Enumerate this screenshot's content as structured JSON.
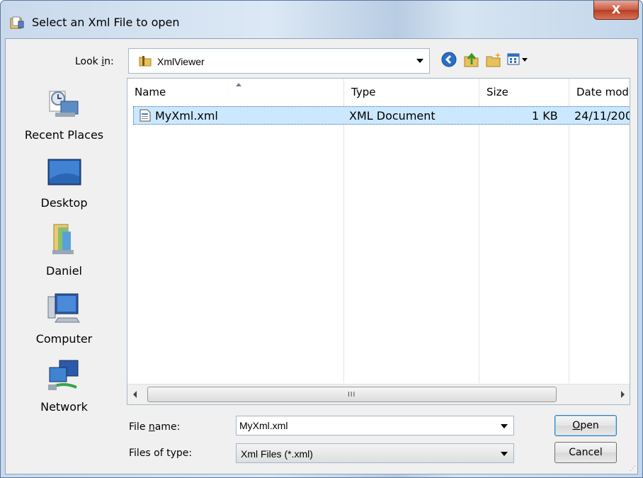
{
  "window": {
    "title": "Select an Xml File to open",
    "close_glyph": "X"
  },
  "lookin": {
    "label": "Look in:",
    "label_prefix": "Look ",
    "label_accel": "i",
    "label_suffix": "n:",
    "value": "XmlViewer"
  },
  "places": [
    {
      "label": "Recent Places",
      "icon": "recent-places-icon"
    },
    {
      "label": "Desktop",
      "icon": "desktop-icon"
    },
    {
      "label": "Daniel",
      "icon": "user-folder-icon"
    },
    {
      "label": "Computer",
      "icon": "computer-icon"
    },
    {
      "label": "Network",
      "icon": "network-icon"
    }
  ],
  "columns": {
    "name": "Name",
    "type": "Type",
    "size": "Size",
    "date": "Date mod"
  },
  "files": [
    {
      "name": "MyXml.xml",
      "type": "XML Document",
      "size": "1 KB",
      "date": "24/11/200"
    }
  ],
  "scrollbar": {
    "grip": "III"
  },
  "filename": {
    "label_prefix": "File ",
    "label_accel": "n",
    "label_suffix": "ame:",
    "value": "MyXml.xml"
  },
  "filetype": {
    "label": "Files of type:",
    "value": "Xml Files (*.xml)"
  },
  "buttons": {
    "open_accel": "O",
    "open_rest": "pen",
    "cancel": "Cancel"
  },
  "colors": {
    "selection": "#cce8ff",
    "close": "#c75a42"
  }
}
